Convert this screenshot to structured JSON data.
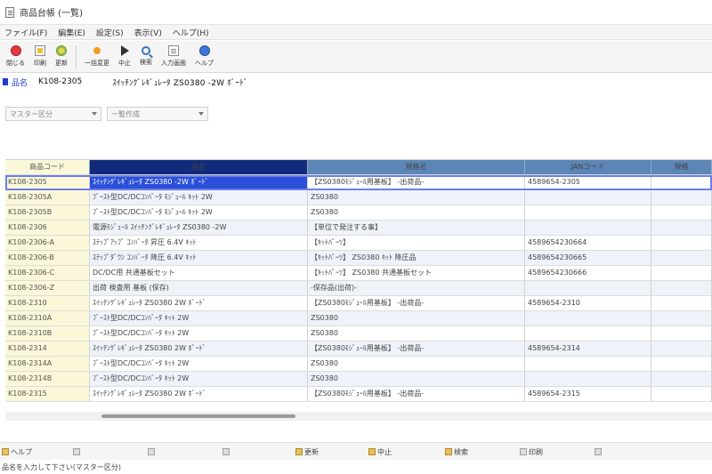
{
  "window": {
    "title": "商品台帳 (一覧)"
  },
  "menu": [
    "ファイル(F)",
    "編集(E)",
    "設定(S)",
    "表示(V)",
    "ヘルプ(H)"
  ],
  "toolbar": [
    {
      "label": "閉じる",
      "icon": "close-icon"
    },
    {
      "label": "印刷",
      "icon": "print-icon"
    },
    {
      "label": "更新",
      "icon": "refresh-icon"
    },
    {
      "label": "一括変更",
      "icon": "batch-edit-icon"
    },
    {
      "label": "中止",
      "icon": "stop-icon"
    },
    {
      "label": "検索",
      "icon": "search-icon"
    },
    {
      "label": "入力画面",
      "icon": "input-screen-icon"
    },
    {
      "label": "ヘルプ",
      "icon": "help-icon"
    }
  ],
  "path": {
    "label": "品名",
    "code": "K108-2305",
    "name": "ｽｲｯﾁﾝｸﾞﾚｷﾞｭﾚｰﾀ ZS0380 -2W ﾎﾞｰﾄﾞ"
  },
  "filters": [
    {
      "value": "マスター区分"
    },
    {
      "value": "一覧作成"
    }
  ],
  "grid": {
    "headers": [
      "商品コード",
      "品名",
      "規格名",
      "JANコード",
      "規格"
    ],
    "rows": [
      [
        "K108-2305",
        "ｽｲｯﾁﾝｸﾞﾚｷﾞｭﾚｰﾀ ZS0380 -2W ﾎﾞｰﾄﾞ",
        "【ZS0380ﾓｼﾞｭｰﾙ用基板】  -出荷品-",
        "4589654-2305",
        ""
      ],
      [
        "K108-2305A",
        "ﾌﾞｰｽﾄ型DC/DCｺﾝﾊﾞｰﾀ ﾓｼﾞｭｰﾙ ｷｯﾄ 2W",
        "ZS0380",
        "",
        ""
      ],
      [
        "K108-2305B",
        "ﾌﾞｰｽﾄ型DC/DCｺﾝﾊﾞｰﾀ ﾓｼﾞｭｰﾙ ｷｯﾄ 2W",
        "ZS0380",
        "",
        ""
      ],
      [
        "K108-2306",
        "電源ﾓｼﾞｭｰﾙ ｽｲｯﾁﾝｸﾞﾚｷﾞｭﾚｰﾀ ZS0380 -2W",
        "【単位で発注する事】",
        "",
        ""
      ],
      [
        "K108-2306-A",
        "ｽﾃｯﾌﾟｱｯﾌﾟ ｺﾝﾊﾞｰﾀ 昇圧 6.4V ｷｯﾄ",
        "【ｷｯﾄﾊﾟｰﾂ】",
        "4589654230664",
        ""
      ],
      [
        "K108-2306-B",
        "ｽﾃｯﾌﾟﾀﾞｳﾝ ｺﾝﾊﾞｰﾀ 降圧 6.4V ｷｯﾄ",
        "【ｷｯﾄﾊﾟｰﾂ】  ZS0380 ｷｯﾄ 降圧品",
        "4589654230665",
        ""
      ],
      [
        "K108-2306-C",
        "DC/DC用 共通基板セット",
        "【ｷｯﾄﾊﾟｰﾂ】  ZS0380  共通基板セット",
        "4589654230666",
        ""
      ],
      [
        "K108-2306-Z",
        "出荷 検査用 基板 (保存)",
        "-保存品(出荷)-",
        "",
        ""
      ],
      [
        "K108-2310",
        "ｽｲｯﾁﾝｸﾞﾚｷﾞｭﾚｰﾀ ZS0380 2W ﾎﾞｰﾄﾞ",
        "【ZS0380ﾓｼﾞｭｰﾙ用基板】  -出荷品-",
        "4589654-2310",
        ""
      ],
      [
        "K108-2310A",
        "ﾌﾞｰｽﾄ型DC/DCｺﾝﾊﾞｰﾀ ｷｯﾄ 2W",
        "ZS0380",
        "",
        ""
      ],
      [
        "K108-2310B",
        "ﾌﾞｰｽﾄ型DC/DCｺﾝﾊﾞｰﾀ ｷｯﾄ 2W",
        "ZS0380",
        "",
        ""
      ],
      [
        "K108-2314",
        "ｽｲｯﾁﾝｸﾞﾚｷﾞｭﾚｰﾀ ZS0380 2W ﾎﾞｰﾄﾞ",
        "【ZS0380ﾓｼﾞｭｰﾙ用基板】  -出荷品-",
        "4589654-2314",
        ""
      ],
      [
        "K108-2314A",
        "ﾌﾞｰｽﾄ型DC/DCｺﾝﾊﾞｰﾀ ｷｯﾄ 2W",
        "ZS0380",
        "",
        ""
      ],
      [
        "K108-2314B",
        "ﾌﾞｰｽﾄ型DC/DCｺﾝﾊﾞｰﾀ ｷｯﾄ 2W",
        "ZS0380",
        "",
        ""
      ],
      [
        "K108-2315",
        "ｽｲｯﾁﾝｸﾞﾚｷﾞｭﾚｰﾀ ZS0380 2W ﾎﾞｰﾄﾞ",
        "【ZS0380ﾓｼﾞｭｰﾙ用基板】  -出荷品-",
        "4589654-2315",
        ""
      ]
    ]
  },
  "fkeys": [
    {
      "label": "ヘルプ"
    },
    {
      "label": ""
    },
    {
      "label": ""
    },
    {
      "label": ""
    },
    {
      "label": "更新"
    },
    {
      "label": "中止"
    },
    {
      "label": "検索"
    },
    {
      "label": "印刷"
    },
    {
      "label": ""
    }
  ],
  "status": "品名を入力して下さい(マスター区分)"
}
